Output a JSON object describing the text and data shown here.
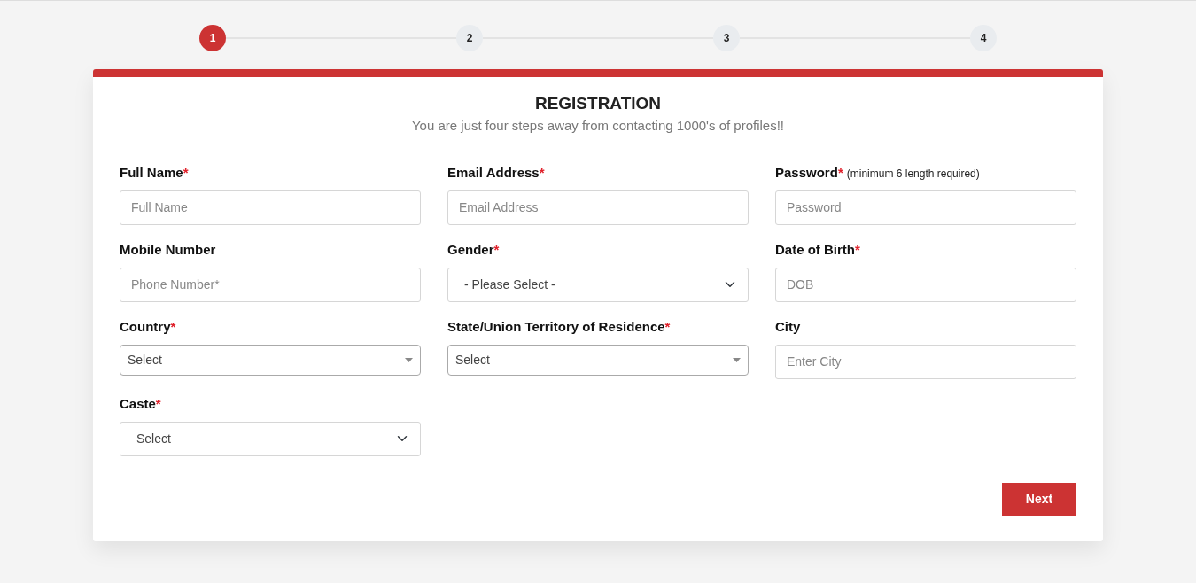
{
  "steps": [
    {
      "label": "1",
      "selected": true
    },
    {
      "label": "2",
      "selected": false
    },
    {
      "label": "3",
      "selected": false
    },
    {
      "label": "4",
      "selected": false
    }
  ],
  "form": {
    "title": "REGISTRATION",
    "subtitle": "You are just four steps away from contacting 1000's of profiles!!",
    "fields": [
      {
        "label": "Full Name",
        "required_mark": "*",
        "kind": "input",
        "placeholder": "Full Name"
      },
      {
        "label": "Email Address",
        "required_mark": "*",
        "kind": "input",
        "placeholder": "Email Address"
      },
      {
        "label": "Password",
        "required_mark": "*",
        "note": "(minimum 6 length required)",
        "kind": "input",
        "placeholder": "Password"
      },
      {
        "label": "Mobile Number",
        "kind": "input",
        "placeholder": "Phone Number*"
      },
      {
        "label": "Gender",
        "required_mark": "*",
        "kind": "select",
        "value": "- Please Select -"
      },
      {
        "label": "Date of Birth",
        "required_mark": "*",
        "kind": "input",
        "placeholder": "DOB"
      },
      {
        "label": "Country",
        "required_mark": "*",
        "kind": "combo",
        "value": "Select"
      },
      {
        "label": "State/Union Territory of Residence",
        "required_mark": "*",
        "kind": "combo",
        "value": "Select"
      },
      {
        "label": "City",
        "kind": "input",
        "placeholder": "Enter City"
      },
      {
        "label": "Caste",
        "required_mark": "*",
        "kind": "select",
        "value": "Select"
      }
    ],
    "next_button": "Next"
  }
}
